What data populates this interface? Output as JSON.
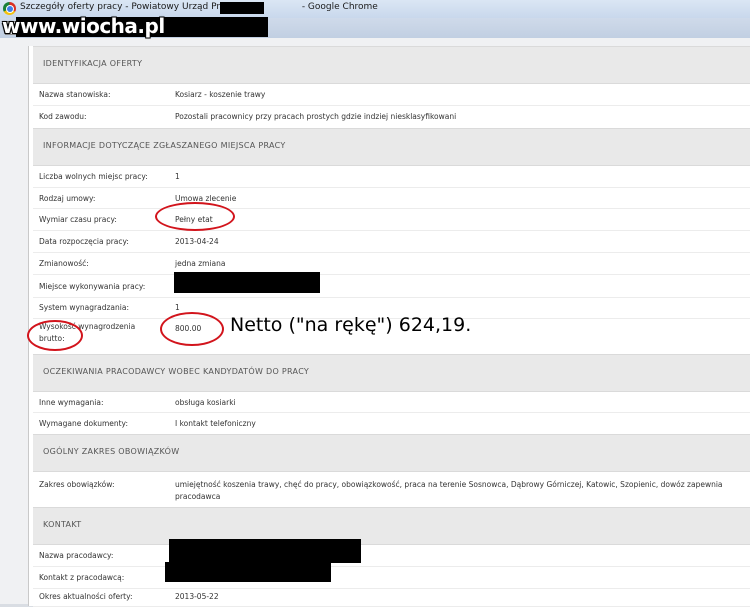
{
  "window": {
    "title_prefix": "Szczegóły oferty pracy - Powiatowy Urząd Pracy w",
    "title_suffix": "- Google Chrome"
  },
  "watermark": "www.wiocha.pl",
  "sections": {
    "identification": "IDENTYFIKACJA OFERTY",
    "workplace": "INFORMACJE DOTYCZĄCE ZGŁASZANEGO MIEJSCA PRACY",
    "expectations": "OCZEKIWANIA PRACODAWCY WOBEC KANDYDATÓW DO PRACY",
    "scope": "OGÓLNY ZAKRES OBOWIĄZKÓW",
    "contact": "KONTAKT"
  },
  "fields": {
    "position_label": "Nazwa stanowiska:",
    "position_value": "Kosiarz - koszenie trawy",
    "code_label": "Kod zawodu:",
    "code_value": "Pozostali pracownicy przy pracach prostych gdzie indziej niesklasyfikowani",
    "vacancies_label": "Liczba wolnych miejsc pracy:",
    "vacancies_value": "1",
    "contract_label": "Rodzaj umowy:",
    "contract_value": "Umowa zlecenie",
    "worktime_label": "Wymiar czasu pracy:",
    "worktime_value": "Pełny etat",
    "start_label": "Data rozpoczęcia pracy:",
    "start_value": "2013-04-24",
    "shifts_label": "Zmianowość:",
    "shifts_value": "jedna zmiana",
    "place_label": "Miejsce wykonywania pracy:",
    "pay_system_label": "System wynagradzania:",
    "pay_system_value": "1",
    "salary_label_line1": "Wysokość wynagrodzenia",
    "salary_label_line2": "brutto:",
    "salary_value": "800.00",
    "other_req_label": "Inne wymagania:",
    "other_req_value": "obsługa kosiarki",
    "docs_label": "Wymagane dokumenty:",
    "docs_value": "I kontakt telefoniczny",
    "duties_label": "Zakres obowiązków:",
    "duties_value_line1": "umiejętność koszenia trawy, chęć do pracy, obowiązkowość, praca na terenie Sosnowca, Dąbrowy Górniczej, Katowic, Szopienic, dowóz zapewnia",
    "duties_value_line2": "pracodawca",
    "employer_label": "Nazwa pracodawcy:",
    "employer_contact_label": "Kontakt z pracodawcą:",
    "validity_label": "Okres aktualności oferty:",
    "validity_value": "2013-05-22"
  },
  "annotation": "Netto (\"na rękę\") 624,19.",
  "colors": {
    "accent_red": "#d2141c",
    "section_bg": "#e9e9e9"
  }
}
